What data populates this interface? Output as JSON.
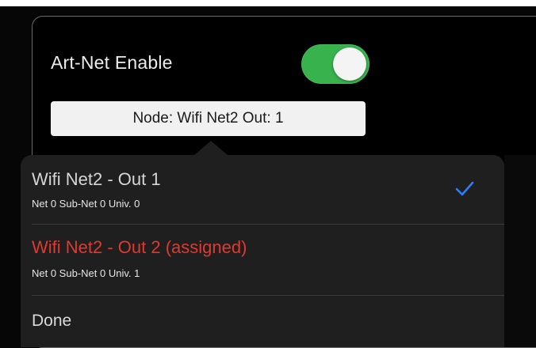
{
  "artnet": {
    "enable_label": "Art-Net Enable",
    "enabled": true
  },
  "node_button": {
    "label": "Node: Wifi Net2 Out: 1"
  },
  "popover": {
    "options": [
      {
        "title": "Wifi Net2 - Out 1",
        "subtitle": "Net 0  Sub-Net 0 Univ. 0",
        "selected": true,
        "assigned": false,
        "icon": "checkmark-icon"
      },
      {
        "title": "Wifi Net2 - Out 2 (assigned)",
        "subtitle": "Net 0  Sub-Net 0 Univ. 1",
        "selected": false,
        "assigned": true
      }
    ],
    "done_label": "Done"
  },
  "colors": {
    "toggle_on": "#37b24d",
    "assigned_text": "#e2382f",
    "checkmark": "#2f7cf6",
    "popover_bg": "#1f1f1f"
  }
}
